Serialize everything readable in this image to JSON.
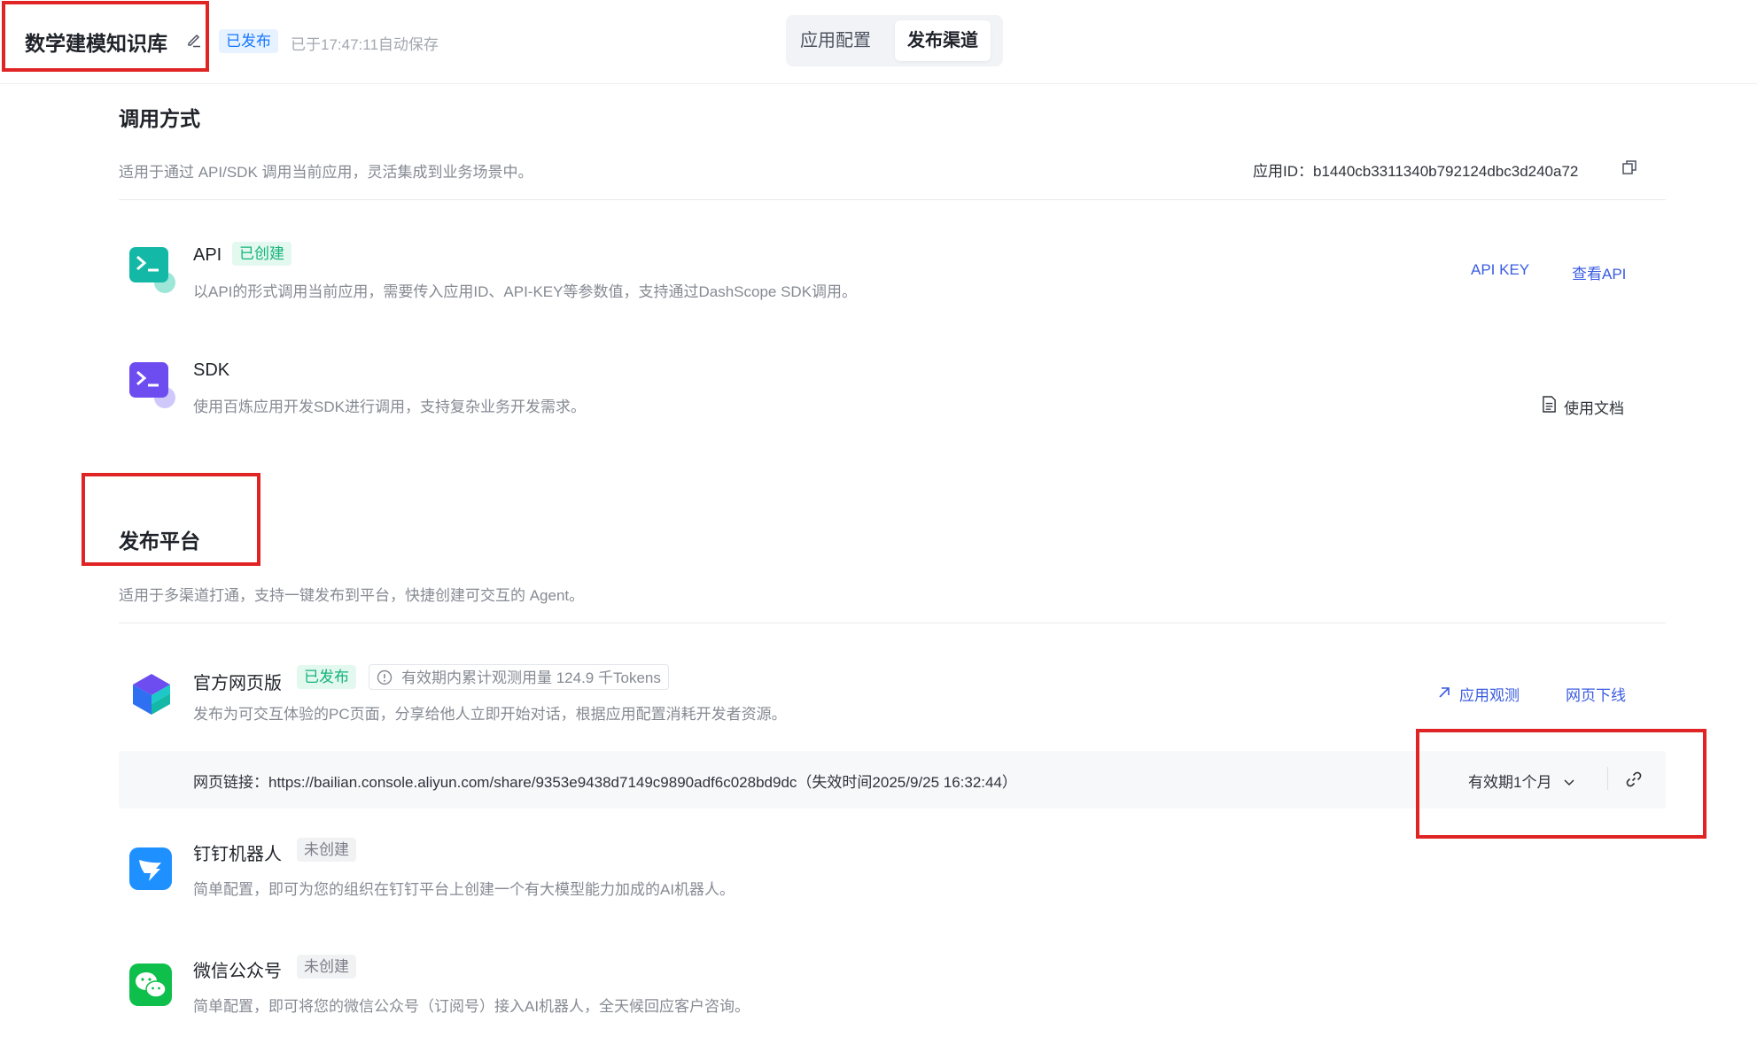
{
  "header": {
    "app_title": "数学建模知识库",
    "status_badge": "已发布",
    "autosave_text": "已于17:47:11自动保存",
    "tabs": [
      {
        "label": "应用配置",
        "active": false
      },
      {
        "label": "发布渠道",
        "active": true
      }
    ]
  },
  "invoke": {
    "title": "调用方式",
    "description": "适用于通过 API/SDK 调用当前应用，灵活集成到业务场景中。",
    "app_id_label": "应用ID：",
    "app_id_value": "b1440cb3311340b792124dbc3d240a72",
    "api": {
      "title": "API",
      "tag": "已创建",
      "description": "以API的形式调用当前应用，需要传入应用ID、API-KEY等参数值，支持通过DashScope SDK调用。",
      "action_api_key": "API KEY",
      "action_view_api": "查看API"
    },
    "sdk": {
      "title": "SDK",
      "description": "使用百炼应用开发SDK进行调用，支持复杂业务开发需求。",
      "action_docs": "使用文档"
    }
  },
  "publish": {
    "title": "发布平台",
    "description": "适用于多渠道打通，支持一键发布到平台，快捷创建可交互的 Agent。",
    "web": {
      "title": "官方网页版",
      "tag": "已发布",
      "tokens_info": "有效期内累计观测用量 124.9 千Tokens",
      "description": "发布为可交互体验的PC页面，分享给他人立即开始对话，根据应用配置消耗开发者资源。",
      "action_observe": "应用观测",
      "action_offline": "网页下线",
      "link_label": "网页链接：",
      "link_url": "https://bailian.console.aliyun.com/share/9353e9438d7149c9890adf6c028bd9dc",
      "link_expire": "（失效时间2025/9/25 16:32:44）",
      "validity": "有效期1个月"
    },
    "dingtalk": {
      "title": "钉钉机器人",
      "tag": "未创建",
      "description": "简单配置，即可为您的组织在钉钉平台上创建一个有大模型能力加成的AI机器人。"
    },
    "wechat": {
      "title": "微信公众号",
      "tag": "未创建",
      "description": "简单配置，即可将您的微信公众号（订阅号）接入AI机器人，全天候回应客户咨询。"
    }
  },
  "colors": {
    "primary_link": "#3a5ce0",
    "published_blue": "#1677ff",
    "created_green": "#16b37a",
    "annotation_red": "#e02424"
  }
}
